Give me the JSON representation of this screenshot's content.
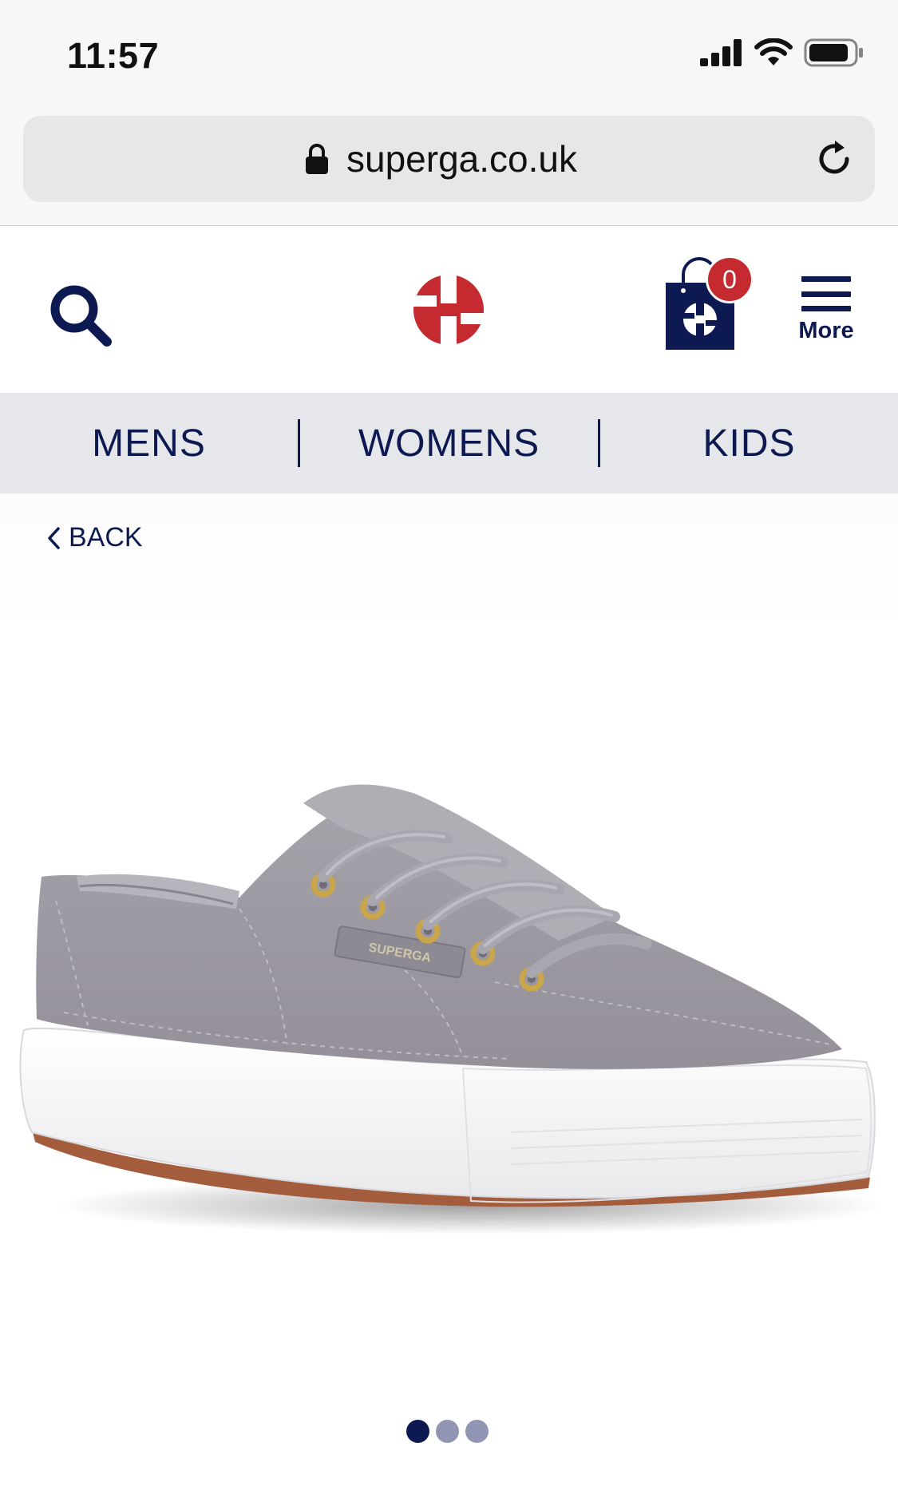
{
  "status_bar": {
    "time": "11:57"
  },
  "browser": {
    "url": "superga.co.uk"
  },
  "header": {
    "cart_count": "0",
    "more_label": "More"
  },
  "nav": {
    "categories": [
      "MENS",
      "WOMENS",
      "KIDS"
    ]
  },
  "back_label": "BACK",
  "product": {
    "logo_text": "SUPERGA"
  },
  "carousel": {
    "total": 3,
    "active_index": 0
  },
  "colors": {
    "brand_navy": "#0d1a52",
    "brand_red": "#c42a2f",
    "nav_background": "#e6e7ea"
  },
  "icons": {
    "search": "search-icon",
    "cart": "shopping-bag-icon",
    "menu": "hamburger-icon",
    "lock": "lock-icon",
    "reload": "reload-icon",
    "back": "chevron-left-icon"
  }
}
